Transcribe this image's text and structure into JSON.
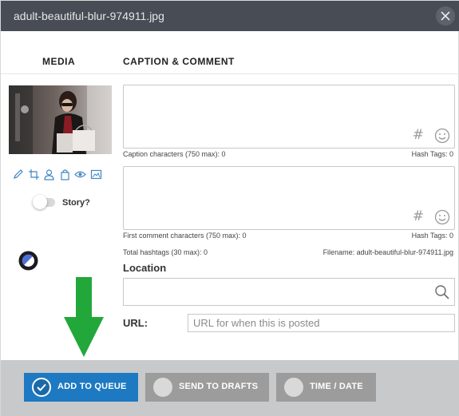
{
  "window": {
    "title": "adult-beautiful-blur-974911.jpg"
  },
  "columns": {
    "media": "MEDIA",
    "caption_comment": "CAPTION & COMMENT"
  },
  "media": {
    "tools": [
      "edit-icon",
      "crop-icon",
      "tag-user-icon",
      "shopping-bag-icon",
      "preview-eye-icon",
      "image-gallery-icon"
    ],
    "story_label": "Story?",
    "story_enabled": false
  },
  "caption": {
    "value": "",
    "chars_label": "Caption characters (750 max): 0",
    "hashtags_label": "Hash Tags: 0"
  },
  "first_comment": {
    "value": "",
    "chars_label": "First comment characters (750 max): 0",
    "hashtags_label": "Hash Tags: 0"
  },
  "totals": {
    "total_hashtags": "Total hashtags (30 max): 0",
    "filename": "Filename: adult-beautiful-blur-974911.jpg"
  },
  "location": {
    "label": "Location",
    "value": ""
  },
  "url": {
    "label": "URL:",
    "placeholder": "URL for when this is posted",
    "value": ""
  },
  "actions": {
    "add_to_queue": "ADD TO QUEUE",
    "send_to_drafts": "SEND TO DRAFTS",
    "time_date": "TIME / DATE"
  },
  "colors": {
    "title_bar": "#474c55",
    "primary": "#1d79c2",
    "secondary_button": "#9c9c9c",
    "footer": "#c8c9cb",
    "annotation_arrow": "#22a83a"
  }
}
